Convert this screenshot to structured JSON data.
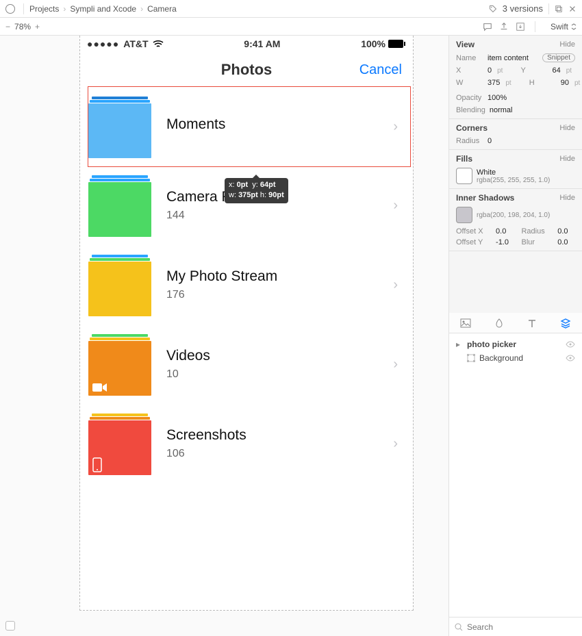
{
  "breadcrumb": {
    "root": "Projects",
    "group": "Sympli and Xcode",
    "item": "Camera"
  },
  "versions": "3 versions",
  "toolbar": {
    "zoom": "78%",
    "lang": "Swift"
  },
  "statusbar": {
    "carrier": "AT&T",
    "time": "9:41 AM",
    "battery": "100%"
  },
  "nav": {
    "title": "Photos",
    "cancel": "Cancel"
  },
  "items": [
    {
      "name": "Moments",
      "count": "",
      "colors": {
        "stack1": "#1f7fd6",
        "stack2": "#2aa5ff",
        "main": "#5cb8f5"
      },
      "selected": true
    },
    {
      "name": "Camera Roll",
      "count": "144",
      "colors": {
        "stack1": "#2aa5ff",
        "stack2": "#2aa5ff",
        "main": "#4cd964"
      }
    },
    {
      "name": "My Photo Stream",
      "count": "176",
      "colors": {
        "stack1": "#2aa5ff",
        "stack2": "#4cd964",
        "main": "#f5c21b"
      },
      "icon": ""
    },
    {
      "name": "Videos",
      "count": "10",
      "colors": {
        "stack1": "#4cd964",
        "stack2": "#f5c21b",
        "main": "#f08a1a"
      },
      "icon": "video"
    },
    {
      "name": "Screenshots",
      "count": "106",
      "colors": {
        "stack1": "#f5c21b",
        "stack2": "#f08a1a",
        "main": "#f04a3e"
      },
      "icon": "phone"
    }
  ],
  "tooltip": {
    "xk": "x:",
    "xv": "0pt",
    "yk": "y:",
    "yv": "64pt",
    "wk": "w:",
    "wv": "375pt",
    "hk": "h:",
    "hv": "90pt"
  },
  "inspector": {
    "view": {
      "head": "View",
      "hide": "Hide",
      "nameK": "Name",
      "nameV": "item content",
      "snippet": "Snippet",
      "xK": "X",
      "xV": "0",
      "yK": "Y",
      "yV": "64",
      "wK": "W",
      "wV": "375",
      "hK": "H",
      "hV": "90",
      "opK": "Opacity",
      "opV": "100%",
      "blK": "Blending",
      "blV": "normal",
      "unit": "pt"
    },
    "corners": {
      "head": "Corners",
      "radiusK": "Radius",
      "radiusV": "0"
    },
    "fills": {
      "head": "Fills",
      "name": "White",
      "rgba": "rgba(255, 255, 255, 1.0)"
    },
    "inner": {
      "head": "Inner Shadows",
      "rgba": "rgba(200, 198, 204, 1.0)",
      "oxK": "Offset X",
      "oxV": "0.0",
      "rK": "Radius",
      "rV": "0.0",
      "oyK": "Offset Y",
      "oyV": "-1.0",
      "bK": "Blur",
      "bV": "0.0"
    }
  },
  "layers": {
    "root": "photo picker",
    "child": "Background"
  },
  "search": {
    "placeholder": "Search"
  }
}
